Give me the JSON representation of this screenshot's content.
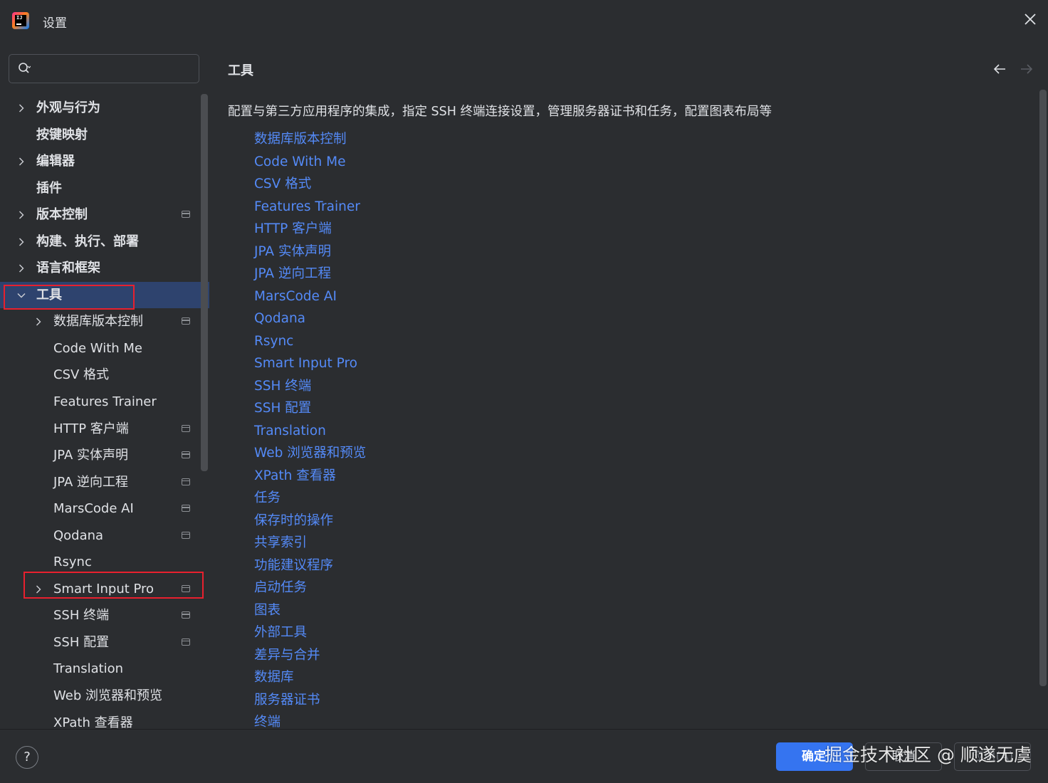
{
  "window": {
    "title": "设置",
    "app_icon": "jetbrains-ij-icon"
  },
  "search": {
    "value": "",
    "placeholder": ""
  },
  "sidebar": {
    "top_items": [
      {
        "label": "外观与行为",
        "expandable": true
      },
      {
        "label": "按键映射",
        "expandable": false
      },
      {
        "label": "编辑器",
        "expandable": true
      },
      {
        "label": "插件",
        "expandable": false
      },
      {
        "label": "版本控制",
        "expandable": true,
        "project_level": true
      },
      {
        "label": "构建、执行、部署",
        "expandable": true
      },
      {
        "label": "语言和框架",
        "expandable": true
      },
      {
        "label": "工具",
        "expandable": true,
        "expanded": true,
        "selected": true
      }
    ],
    "tool_children": [
      {
        "label": "数据库版本控制",
        "expandable": true,
        "project_level": true
      },
      {
        "label": "Code With Me"
      },
      {
        "label": "CSV 格式"
      },
      {
        "label": "Features Trainer"
      },
      {
        "label": "HTTP 客户端",
        "project_level": true
      },
      {
        "label": "JPA 实体声明",
        "project_level": true
      },
      {
        "label": "JPA 逆向工程",
        "project_level": true
      },
      {
        "label": "MarsCode AI",
        "project_level": true
      },
      {
        "label": "Qodana",
        "project_level": true
      },
      {
        "label": "Rsync"
      },
      {
        "label": "Smart Input Pro",
        "expandable": true,
        "project_level": true
      },
      {
        "label": "SSH 终端",
        "project_level": true
      },
      {
        "label": "SSH 配置",
        "project_level": true
      },
      {
        "label": "Translation"
      },
      {
        "label": "Web 浏览器和预览"
      },
      {
        "label": "XPath 查看器"
      }
    ]
  },
  "content": {
    "title": "工具",
    "description": "配置与第三方应用程序的集成，指定 SSH 终端连接设置，管理服务器证书和任务，配置图表布局等",
    "links": [
      "数据库版本控制",
      "Code With Me",
      "CSV 格式",
      "Features Trainer",
      "HTTP 客户端",
      "JPA 实体声明",
      "JPA 逆向工程",
      "MarsCode AI",
      "Qodana",
      "Rsync",
      "Smart Input Pro",
      "SSH 终端",
      "SSH 配置",
      "Translation",
      "Web 浏览器和预览",
      "XPath 查看器",
      "任务",
      "保存时的操作",
      "共享索引",
      "功能建议程序",
      "启动任务",
      "图表",
      "外部工具",
      "差异与合并",
      "数据库",
      "服务器证书",
      "终端"
    ]
  },
  "footer": {
    "help_label": "?",
    "ok_label": "确定",
    "cancel_label": "取消",
    "apply_label": "应用(A)",
    "watermark": "掘金技术社区 @ 顺遂无虞"
  },
  "colors": {
    "background": "#2b2d30",
    "selection": "#2e436e",
    "link": "#548af7",
    "primary_button": "#3574f0",
    "highlight_box": "#e8202e"
  }
}
